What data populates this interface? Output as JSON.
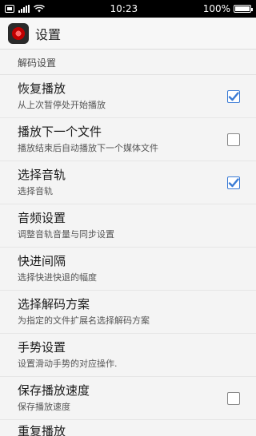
{
  "status_bar": {
    "time": "10:23",
    "battery_percent": "100%",
    "signal_bars": 5,
    "wifi": true
  },
  "app_bar": {
    "title": "设置",
    "icon": "video-player-app-icon"
  },
  "section_header": "解码设置",
  "settings": [
    {
      "title": "恢复播放",
      "subtitle": "从上次暂停处开始播放",
      "checkbox": true,
      "checked": true
    },
    {
      "title": "播放下一个文件",
      "subtitle": "播放结束后自动播放下一个媒体文件",
      "checkbox": true,
      "checked": false
    },
    {
      "title": "选择音轨",
      "subtitle": "选择音轨",
      "checkbox": true,
      "checked": true
    },
    {
      "title": "音频设置",
      "subtitle": "调整音轨音量与同步设置",
      "checkbox": false,
      "checked": false
    },
    {
      "title": "快进间隔",
      "subtitle": "选择快进快退的幅度",
      "checkbox": false,
      "checked": false
    },
    {
      "title": "选择解码方案",
      "subtitle": "为指定的文件扩展名选择解码方案",
      "checkbox": false,
      "checked": false
    },
    {
      "title": "手势设置",
      "subtitle": "设置滑动手势的对应操作.",
      "checkbox": false,
      "checked": false
    },
    {
      "title": "保存播放速度",
      "subtitle": "保存播放速度",
      "checkbox": true,
      "checked": false
    }
  ],
  "partial_row_title": "重复播放",
  "colors": {
    "accent": "#3a7bd5",
    "status_bar_bg": "#000000",
    "background": "#f4f4f4"
  }
}
